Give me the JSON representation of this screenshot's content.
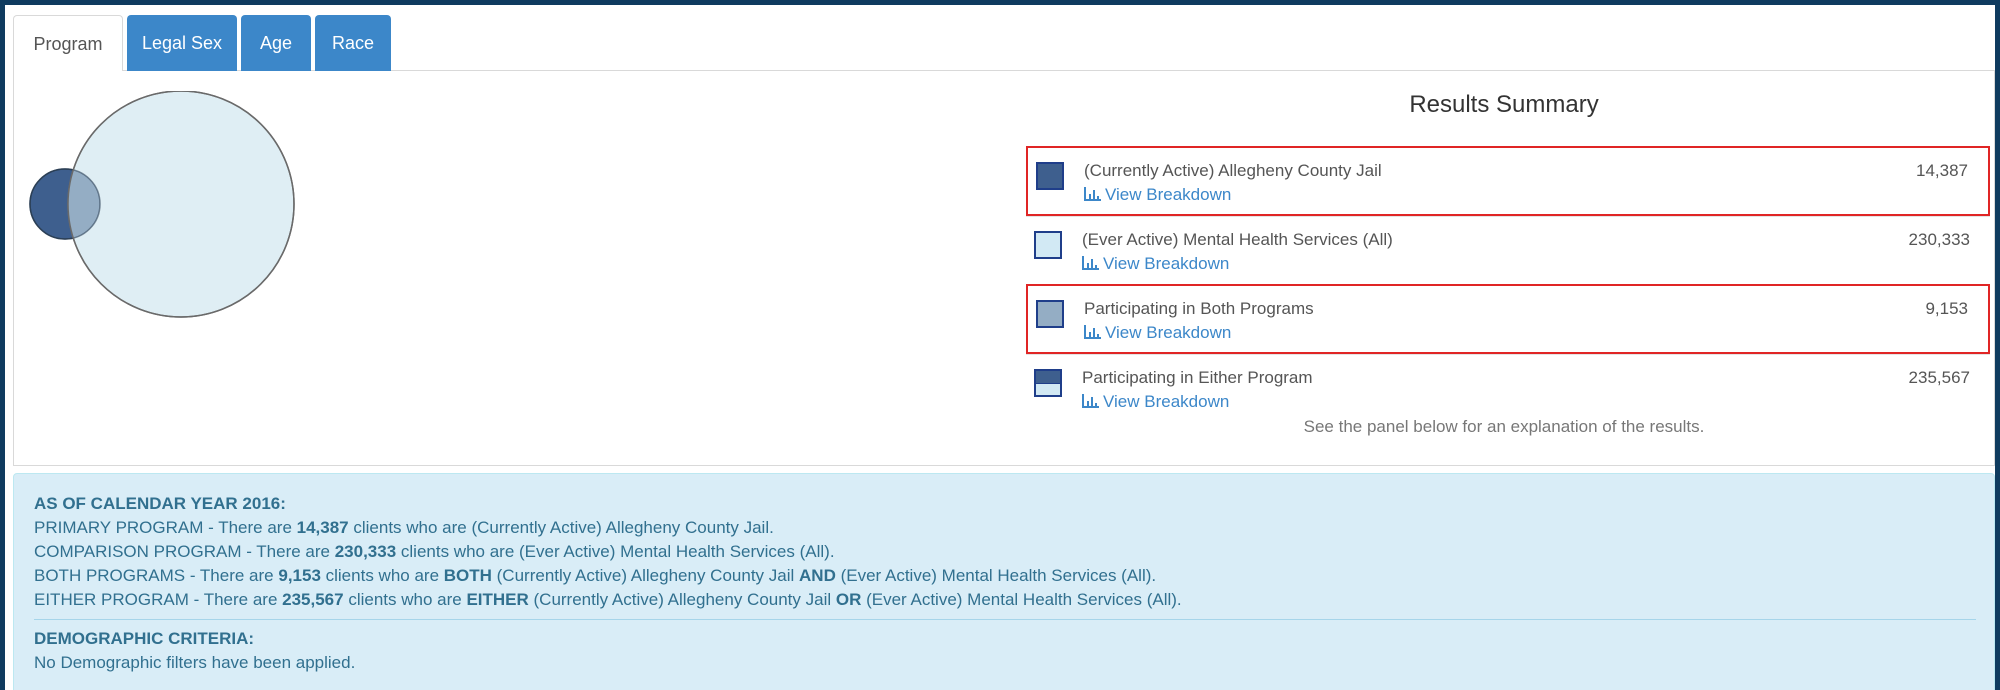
{
  "tabs": [
    {
      "label": "Program",
      "active": true
    },
    {
      "label": "Legal Sex",
      "active": false
    },
    {
      "label": "Age",
      "active": false
    },
    {
      "label": "Race",
      "active": false
    }
  ],
  "colors": {
    "primary": "#3e5f8e",
    "comparison": "#d2e9f4",
    "overlap": "#94adc4",
    "tab_blue": "#3c87c9",
    "highlight_border": "#e02525",
    "info_bg": "#d9edf7",
    "info_text": "#31708f"
  },
  "results": {
    "title": "Results Summary",
    "rows": [
      {
        "label": "(Currently Active) Allegheny County Jail",
        "count": "14,387",
        "link": "View Breakdown",
        "swatch": "primary",
        "highlighted": true
      },
      {
        "label": "(Ever Active) Mental Health Services (All)",
        "count": "230,333",
        "link": "View Breakdown",
        "swatch": "comparison",
        "highlighted": false
      },
      {
        "label": "Participating in Both Programs",
        "count": "9,153",
        "link": "View Breakdown",
        "swatch": "overlap",
        "highlighted": true
      },
      {
        "label": "Participating in Either Program",
        "count": "235,567",
        "link": "View Breakdown",
        "swatch": "split",
        "highlighted": false
      }
    ],
    "note": "See the panel below for an explanation of the results."
  },
  "explanation": {
    "heading": "AS OF CALENDAR YEAR 2016:",
    "primary": {
      "prefix": "PRIMARY PROGRAM - There are ",
      "count": "14,387",
      "suffix": " clients who are (Currently Active) Allegheny County Jail."
    },
    "comparison": {
      "prefix": "COMPARISON PROGRAM - There are ",
      "count": "230,333",
      "suffix": " clients who are (Ever Active) Mental Health Services (All)."
    },
    "both": {
      "prefix": "BOTH PROGRAMS - There are ",
      "count": "9,153",
      "mid1": " clients who are ",
      "kw1": "BOTH",
      "mid2": " (Currently Active) Allegheny County Jail ",
      "kw2": "AND",
      "suffix": " (Ever Active) Mental Health Services (All)."
    },
    "either": {
      "prefix": "EITHER PROGRAM - There are ",
      "count": "235,567",
      "mid1": " clients who are ",
      "kw1": "EITHER",
      "mid2": " (Currently Active) Allegheny County Jail ",
      "kw2": "OR",
      "suffix": " (Ever Active) Mental Health Services (All)."
    },
    "demo_heading": "DEMOGRAPHIC CRITERIA:",
    "demo_text": "No Demographic filters have been applied."
  }
}
